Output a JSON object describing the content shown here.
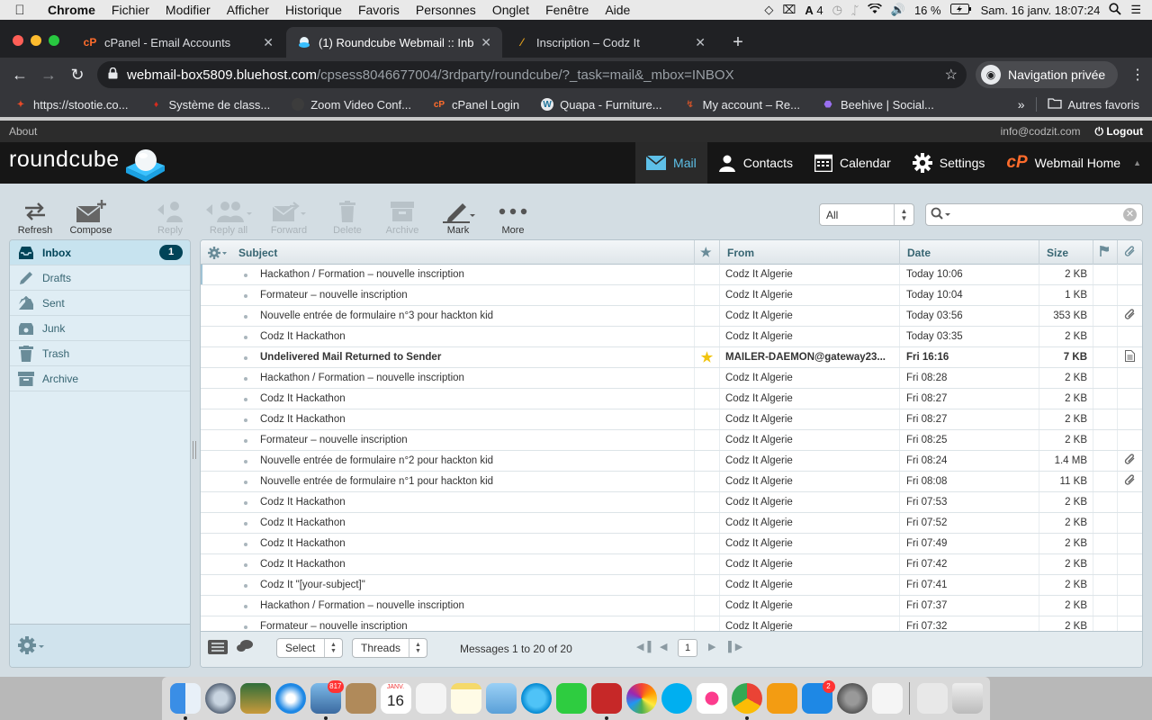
{
  "menubar": {
    "app": "Chrome",
    "items": [
      "Fichier",
      "Modifier",
      "Afficher",
      "Historique",
      "Favoris",
      "Personnes",
      "Onglet",
      "Fenêtre",
      "Aide"
    ],
    "adobe_count": "4",
    "battery": "16 %",
    "clock": "Sam. 16 janv.  18:07:24"
  },
  "tabs": [
    {
      "title": "cPanel - Email Accounts",
      "icon": "cpanel-icon"
    },
    {
      "title": "(1) Roundcube Webmail :: Inbo",
      "icon": "roundcube-icon"
    },
    {
      "title": "Inscription – Codz It",
      "icon": "codzit-icon"
    }
  ],
  "address": {
    "host": "webmail-box5809.bluehost.com",
    "path": "/cpsess8046677004/3rdparty/roundcube/?_task=mail&_mbox=INBOX",
    "mode": "Navigation privée"
  },
  "bookmarks": [
    {
      "label": "https://stootie.co...",
      "color": "#e84a28"
    },
    {
      "label": "Système de class...",
      "color": "#d52b1e"
    },
    {
      "label": "Zoom Video Conf...",
      "color": "#2d8cff"
    },
    {
      "label": "cPanel Login",
      "color": "#ff6c2c"
    },
    {
      "label": "Quapa - Furniture...",
      "color": "#21759b"
    },
    {
      "label": "My account – Re...",
      "color": "#c7512a"
    },
    {
      "label": "Beehive | Social...",
      "color": "#7b4fc7"
    }
  ],
  "bookmarks_other": "Autres favoris",
  "topline": {
    "about": "About",
    "user": "info@codzit.com",
    "logout": "Logout"
  },
  "app": {
    "logo": "roundcube"
  },
  "taskbar": [
    {
      "label": "Mail",
      "icon": "mail-icon"
    },
    {
      "label": "Contacts",
      "icon": "contacts-icon"
    },
    {
      "label": "Calendar",
      "icon": "calendar-icon"
    },
    {
      "label": "Settings",
      "icon": "settings-icon"
    },
    {
      "label": "Webmail Home",
      "icon": "cpanel-icon"
    }
  ],
  "toolbar": {
    "refresh": "Refresh",
    "compose": "Compose",
    "reply": "Reply",
    "reply_all": "Reply all",
    "forward": "Forward",
    "delete": "Delete",
    "archive": "Archive",
    "mark": "Mark",
    "more": "More"
  },
  "filter": "All",
  "folders": [
    {
      "name": "Inbox",
      "unread": "1",
      "icon": "inbox-icon"
    },
    {
      "name": "Drafts",
      "unread": "",
      "icon": "pencil-icon"
    },
    {
      "name": "Sent",
      "unread": "",
      "icon": "sent-icon"
    },
    {
      "name": "Junk",
      "unread": "",
      "icon": "junk-icon"
    },
    {
      "name": "Trash",
      "unread": "",
      "icon": "trash-icon"
    },
    {
      "name": "Archive",
      "unread": "",
      "icon": "archive-icon"
    }
  ],
  "columns": {
    "subject": "Subject",
    "from": "From",
    "date": "Date",
    "size": "Size"
  },
  "messages": [
    {
      "subject": "Hackathon / Formation – nouvelle inscription",
      "from": "Codz It Algerie",
      "date": "Today 10:06",
      "size": "2 KB",
      "flagged": false,
      "unread": false,
      "attachment": ""
    },
    {
      "subject": "Formateur – nouvelle inscription",
      "from": "Codz It Algerie",
      "date": "Today 10:04",
      "size": "1 KB",
      "flagged": false,
      "unread": false,
      "attachment": ""
    },
    {
      "subject": "Nouvelle entrée de formulaire n°3 pour hackton kid",
      "from": "Codz It Algerie",
      "date": "Today 03:56",
      "size": "353 KB",
      "flagged": false,
      "unread": false,
      "attachment": "paperclip"
    },
    {
      "subject": "Codz It Hackathon",
      "from": "Codz It Algerie",
      "date": "Today 03:35",
      "size": "2 KB",
      "flagged": false,
      "unread": false,
      "attachment": ""
    },
    {
      "subject": "Undelivered Mail Returned to Sender",
      "from": "MAILER-DAEMON@gateway23...",
      "date": "Fri 16:16",
      "size": "7 KB",
      "flagged": true,
      "unread": true,
      "attachment": "report"
    },
    {
      "subject": "Hackathon / Formation – nouvelle inscription",
      "from": "Codz It Algerie",
      "date": "Fri 08:28",
      "size": "2 KB",
      "flagged": false,
      "unread": false,
      "attachment": ""
    },
    {
      "subject": "Codz It Hackathon",
      "from": "Codz It Algerie",
      "date": "Fri 08:27",
      "size": "2 KB",
      "flagged": false,
      "unread": false,
      "attachment": ""
    },
    {
      "subject": "Codz It Hackathon",
      "from": "Codz It Algerie",
      "date": "Fri 08:27",
      "size": "2 KB",
      "flagged": false,
      "unread": false,
      "attachment": ""
    },
    {
      "subject": "Formateur – nouvelle inscription",
      "from": "Codz It Algerie",
      "date": "Fri 08:25",
      "size": "2 KB",
      "flagged": false,
      "unread": false,
      "attachment": ""
    },
    {
      "subject": "Nouvelle entrée de formulaire n°2 pour hackton kid",
      "from": "Codz It Algerie",
      "date": "Fri 08:24",
      "size": "1.4 MB",
      "flagged": false,
      "unread": false,
      "attachment": "paperclip"
    },
    {
      "subject": "Nouvelle entrée de formulaire n°1 pour hackton kid",
      "from": "Codz It Algerie",
      "date": "Fri 08:08",
      "size": "11 KB",
      "flagged": false,
      "unread": false,
      "attachment": "paperclip"
    },
    {
      "subject": "Codz It Hackathon",
      "from": "Codz It Algerie",
      "date": "Fri 07:53",
      "size": "2 KB",
      "flagged": false,
      "unread": false,
      "attachment": ""
    },
    {
      "subject": "Codz It Hackathon",
      "from": "Codz It Algerie",
      "date": "Fri 07:52",
      "size": "2 KB",
      "flagged": false,
      "unread": false,
      "attachment": ""
    },
    {
      "subject": "Codz It Hackathon",
      "from": "Codz It Algerie",
      "date": "Fri 07:49",
      "size": "2 KB",
      "flagged": false,
      "unread": false,
      "attachment": ""
    },
    {
      "subject": "Codz It Hackathon",
      "from": "Codz It Algerie",
      "date": "Fri 07:42",
      "size": "2 KB",
      "flagged": false,
      "unread": false,
      "attachment": ""
    },
    {
      "subject": "Codz It \"[your-subject]\"",
      "from": "Codz It Algerie",
      "date": "Fri 07:41",
      "size": "2 KB",
      "flagged": false,
      "unread": false,
      "attachment": ""
    },
    {
      "subject": "Hackathon / Formation – nouvelle inscription",
      "from": "Codz It Algerie",
      "date": "Fri 07:37",
      "size": "2 KB",
      "flagged": false,
      "unread": false,
      "attachment": ""
    },
    {
      "subject": "Formateur – nouvelle inscription",
      "from": "Codz It Algerie",
      "date": "Fri 07:32",
      "size": "2 KB",
      "flagged": false,
      "unread": false,
      "attachment": ""
    }
  ],
  "footer": {
    "select": "Select",
    "threads": "Threads",
    "count": "Messages 1 to 20 of 20",
    "page": "1"
  },
  "dock": {
    "mail_badge": "817",
    "calendar_month": "JANV.",
    "calendar_day": "16",
    "appstore_badge": "2"
  },
  "colors": {
    "accent": "#5ec0e8",
    "brand_dark": "#004458",
    "cpanel_orange": "#ff6c2c"
  }
}
